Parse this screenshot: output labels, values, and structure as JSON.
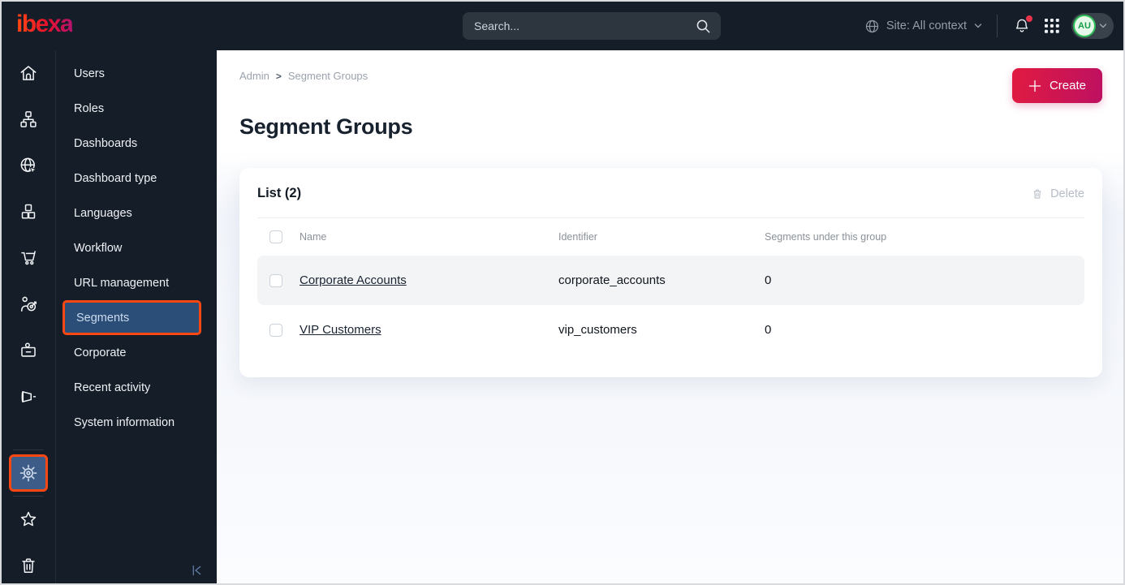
{
  "topbar": {
    "logo_text": "ibexa",
    "search_placeholder": "Search...",
    "site_context_label": "Site: All context",
    "avatar_initials": "AU"
  },
  "sidebar": {
    "menu_items": [
      {
        "label": "Users"
      },
      {
        "label": "Roles"
      },
      {
        "label": "Dashboards"
      },
      {
        "label": "Dashboard type"
      },
      {
        "label": "Languages"
      },
      {
        "label": "Workflow"
      },
      {
        "label": "URL management"
      },
      {
        "label": "Segments",
        "active": true
      },
      {
        "label": "Corporate"
      },
      {
        "label": "Recent activity"
      },
      {
        "label": "System information"
      }
    ]
  },
  "main": {
    "breadcrumb": {
      "items": [
        "Admin",
        "Segment Groups"
      ],
      "separator": ">"
    },
    "page_title": "Segment Groups",
    "create_button_label": "Create",
    "list_card": {
      "title": "List (2)",
      "delete_label": "Delete",
      "columns": [
        "Name",
        "Identifier",
        "Segments under this group"
      ],
      "rows": [
        {
          "name": "Corporate Accounts",
          "identifier": "corporate_accounts",
          "segments_count": "0"
        },
        {
          "name": "VIP Customers",
          "identifier": "vip_customers",
          "segments_count": "0"
        }
      ]
    }
  },
  "colors": {
    "accent_orange": "#ff4713",
    "active_blue": "#2b4e79",
    "topbar_bg": "#151d28",
    "create_gradient_start": "#e01b41",
    "create_gradient_end": "#be1061",
    "avatar_green": "#2fbf58"
  }
}
